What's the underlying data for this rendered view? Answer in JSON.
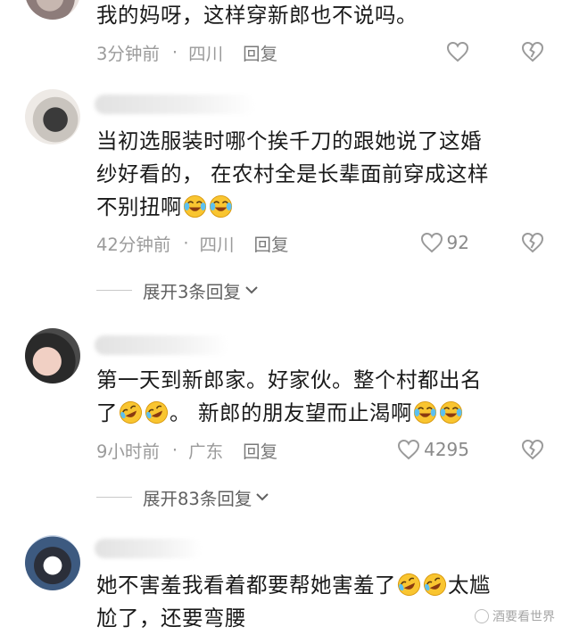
{
  "comments": [
    {
      "text": "我的妈呀，这样穿新郎也不说吗。",
      "time": "3分钟前",
      "location": "四川",
      "reply_label": "回复",
      "likes": ""
    },
    {
      "text_parts": [
        "当初选服装时哪个挨千刀的跟她说了这婚\n纱好看的， 在农村全是长辈面前穿成这样\n不别扭啊"
      ],
      "time": "42分钟前",
      "location": "四川",
      "reply_label": "回复",
      "likes": "92",
      "expand_label": "展开3条回复"
    },
    {
      "text_line1": "第一天到新郎家。好家伙。整个村都出名",
      "text_line2a": "了",
      "text_line2b": "。 新郎的朋友望而止渴啊",
      "time": "9小时前",
      "location": "广东",
      "reply_label": "回复",
      "likes": "4295",
      "expand_label": "展开83条回复"
    },
    {
      "text_line1a": "她不害羞我看着都要帮她害羞了",
      "text_line1b": "太尴",
      "text_line2": "尬了，还要弯腰"
    }
  ],
  "watermark": "酒要看世界",
  "icons": {
    "heart": "heart-icon",
    "broken_heart": "broken-heart-icon",
    "chevron": "chevron-down-icon",
    "emoji": "laughing-tears-emoji"
  }
}
